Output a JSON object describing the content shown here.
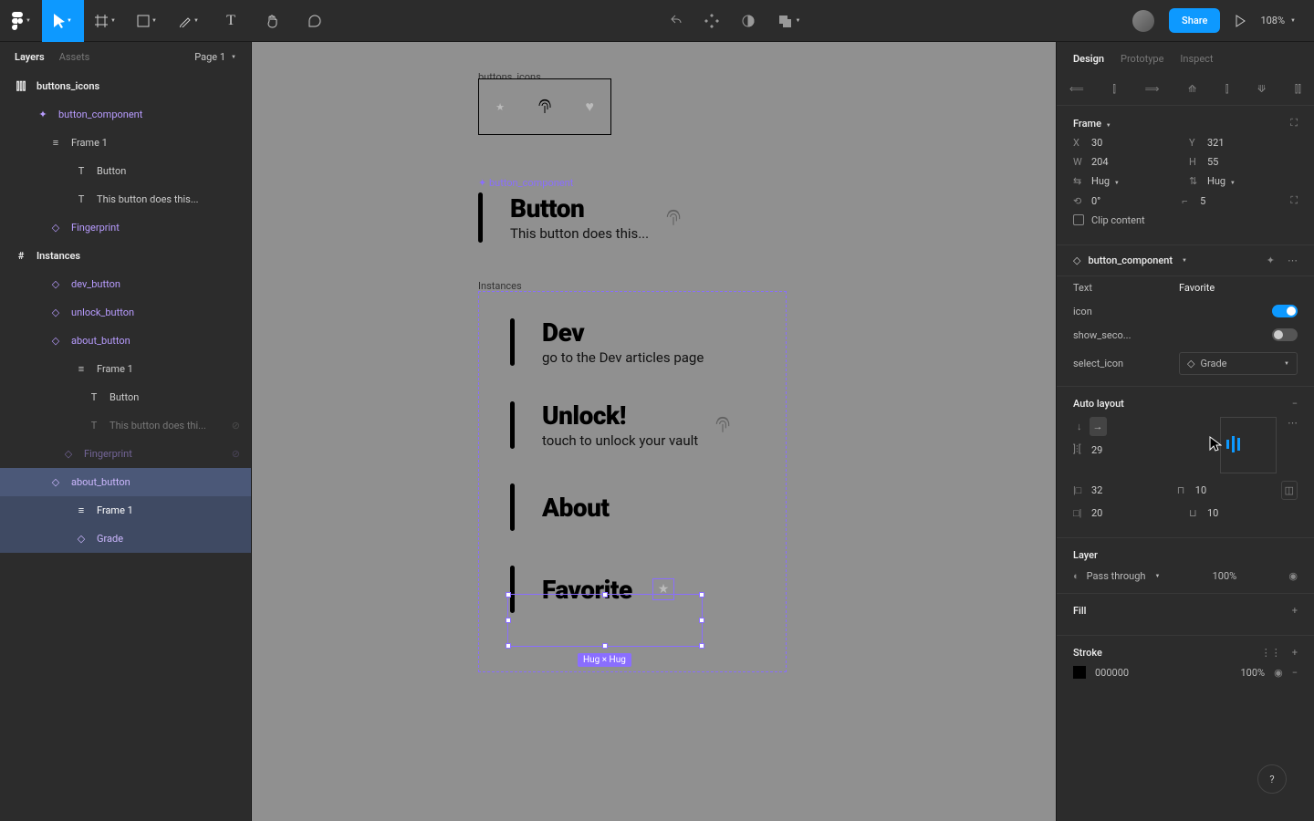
{
  "topbar": {
    "zoom": "108%",
    "share": "Share"
  },
  "leftPanel": {
    "tabLayers": "Layers",
    "tabAssets": "Assets",
    "page": "Page 1",
    "rows": {
      "buttons_icons": "buttons_icons",
      "button_component": "button_component",
      "frame1": "Frame 1",
      "button": "Button",
      "thisButton": "This button does this...",
      "fingerprint": "Fingerprint",
      "instances": "Instances",
      "dev_button": "dev_button",
      "unlock_button": "unlock_button",
      "about_button": "about_button",
      "frame1b": "Frame 1",
      "buttonb": "Button",
      "thisButton2": "This button does thi...",
      "fingerprintb": "Fingerprint",
      "about_button2": "about_button",
      "frame1c": "Frame 1",
      "grade": "Grade"
    }
  },
  "canvas": {
    "labels": {
      "buttons_icons": "buttons_icons",
      "button_component": "button_component",
      "instances": "Instances",
      "hug": "Hug × Hug"
    },
    "mainButton": {
      "title": "Button",
      "sub": "This button does this..."
    },
    "dev": {
      "title": "Dev",
      "sub": "go to the Dev articles page"
    },
    "unlock": {
      "title": "Unlock!",
      "sub": "touch to unlock your vault"
    },
    "about": {
      "title": "About"
    },
    "favorite": {
      "title": "Favorite"
    }
  },
  "rightPanel": {
    "tabDesign": "Design",
    "tabPrototype": "Prototype",
    "tabInspect": "Inspect",
    "frame": "Frame",
    "x": "30",
    "y": "321",
    "w": "204",
    "h": "55",
    "hugW": "Hug",
    "hugH": "Hug",
    "rot": "0°",
    "radius": "5",
    "clip": "Clip content",
    "compName": "button_component",
    "propText": "Text",
    "propTextVal": "Favorite",
    "propIcon": "icon",
    "propShow": "show_seco...",
    "propSelect": "select_icon",
    "propSelectVal": "Grade",
    "autoLayout": "Auto layout",
    "spacing": "29",
    "padL": "32",
    "padR": "10",
    "padT": "20",
    "padB": "10",
    "layer": "Layer",
    "blend": "Pass through",
    "opacity": "100%",
    "fill": "Fill",
    "stroke": "Stroke",
    "strokeHex": "000000",
    "strokePct": "100%"
  },
  "help": "?"
}
